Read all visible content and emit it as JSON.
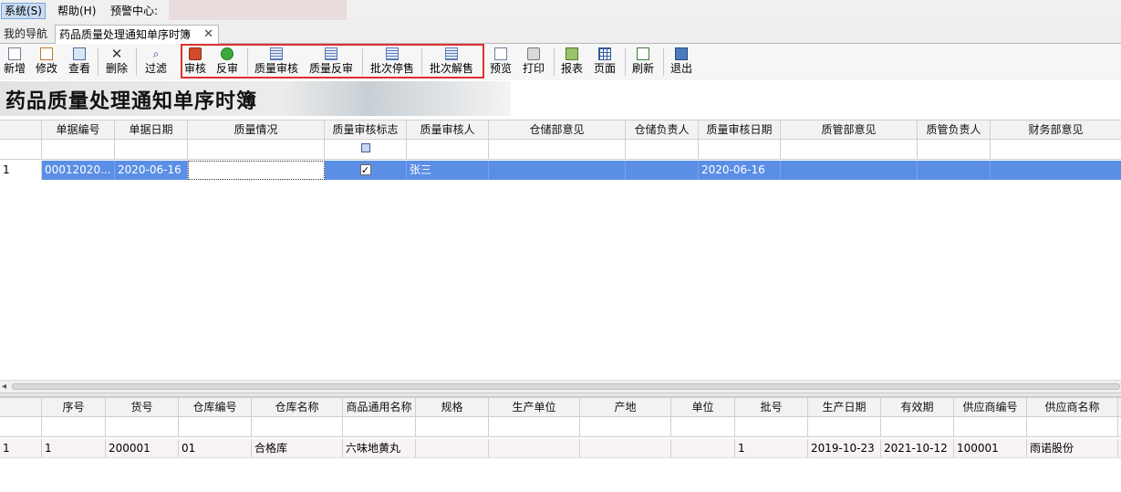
{
  "menubar": {
    "items": [
      "系统(S)",
      "帮助(H)",
      "预警中心:"
    ]
  },
  "tabs": {
    "nav": "我的导航",
    "active": "药品质量处理通知单序时簿",
    "close": "✕"
  },
  "toolbar": {
    "buttons": [
      "新增",
      "修改",
      "查看",
      "删除",
      "过滤",
      "审核",
      "反审",
      "质量审核",
      "质量反审",
      "批次停售",
      "批次解售",
      "预览",
      "打印",
      "报表",
      "页面",
      "刷新",
      "退出"
    ]
  },
  "banner": {
    "title": "药品质量处理通知单序时簿"
  },
  "upper_grid": {
    "columns": [
      "单据编号",
      "单据日期",
      "质量情况",
      "质量审核标志",
      "质量审核人",
      "仓储部意见",
      "仓储负责人",
      "质量审核日期",
      "质管部意见",
      "质管负责人",
      "财务部意见"
    ],
    "rows": [
      {
        "rownum": "1",
        "cells": [
          "00012020...",
          "2020-06-16",
          "",
          "✓",
          "张三",
          "",
          "",
          "2020-06-16",
          "",
          "",
          ""
        ]
      }
    ]
  },
  "lower_grid": {
    "columns": [
      "序号",
      "货号",
      "仓库编号",
      "仓库名称",
      "商品通用名称",
      "规格",
      "生产单位",
      "产地",
      "单位",
      "批号",
      "生产日期",
      "有效期",
      "供应商编号",
      "供应商名称"
    ],
    "rows": [
      {
        "rownum": "1",
        "cells": [
          "1",
          "200001",
          "01",
          "合格库",
          "六味地黄丸",
          "",
          "",
          "",
          "",
          "1",
          "2019-10-23",
          "2021-10-12",
          "100001",
          "雨诺股份"
        ]
      }
    ]
  },
  "colors": {
    "selection": "#5b8fe6",
    "highlight_box": "#e03030"
  }
}
